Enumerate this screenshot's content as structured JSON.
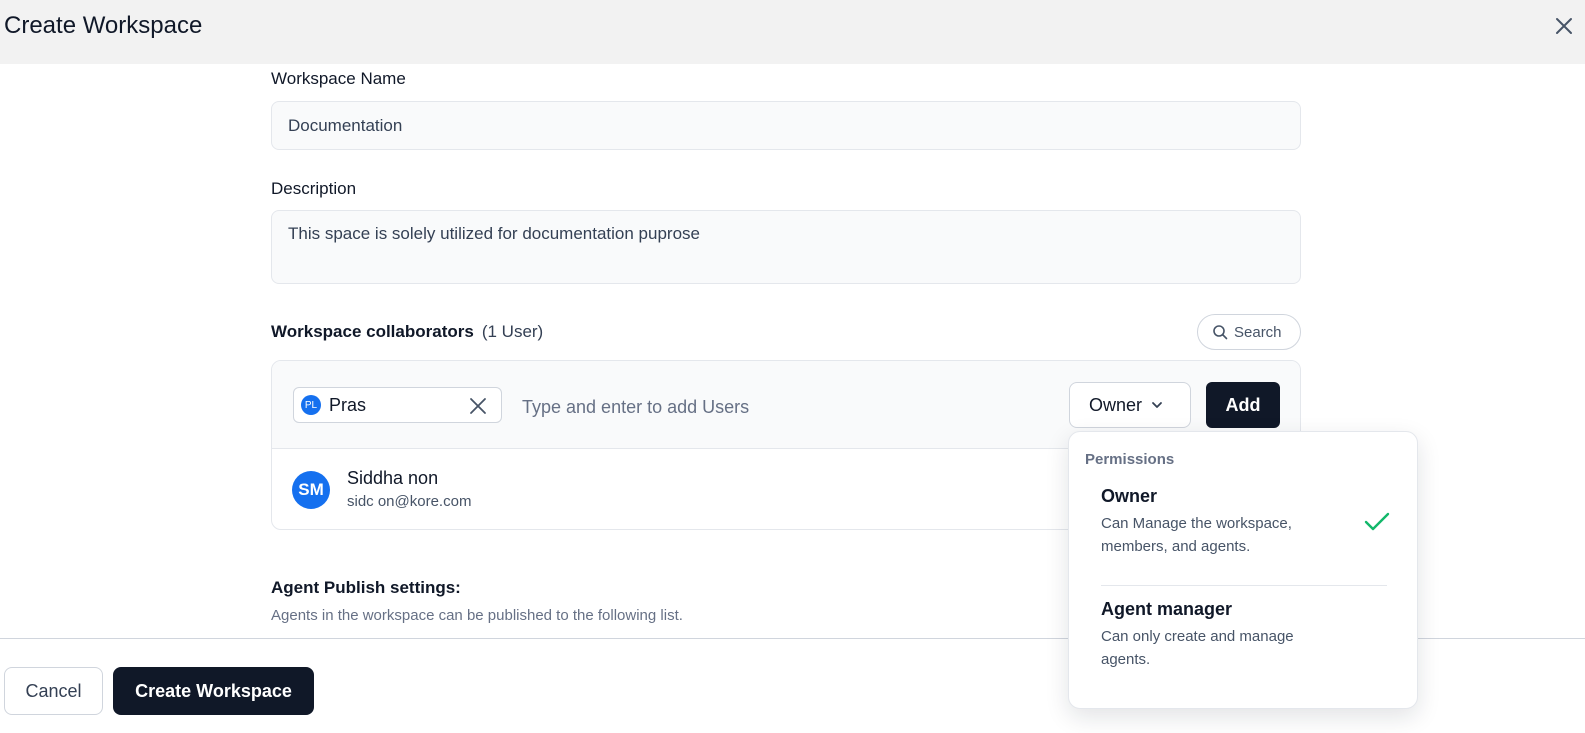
{
  "header": {
    "title": "Create Workspace"
  },
  "form": {
    "name_label": "Workspace Name",
    "name_value": "Documentation",
    "description_label": "Description",
    "description_value": "This space is solely utilized for documentation puprose"
  },
  "collaborators": {
    "title": "Workspace collaborators",
    "count": "(1 User)",
    "search_label": "Search",
    "chip_initials": "PL",
    "chip_text": "Pras",
    "input_placeholder": "Type and enter to add Users",
    "role_value": "Owner",
    "add_label": "Add",
    "users": [
      {
        "initials": "SM",
        "name": "Siddha       non",
        "email": "sidc             on@kore.com"
      }
    ]
  },
  "publish": {
    "title": "Agent Publish settings:",
    "description": "Agents in the workspace can be published to the following list."
  },
  "footer": {
    "cancel_label": "Cancel",
    "create_label": "Create Workspace"
  },
  "permissions_dropdown": {
    "heading": "Permissions",
    "options": [
      {
        "title": "Owner",
        "description": "Can Manage the workspace, members, and agents.",
        "selected": true
      },
      {
        "title": "Agent manager",
        "description": "Can only create and manage agents.",
        "selected": false
      }
    ]
  },
  "colors": {
    "primary_dark": "#101828",
    "avatar_blue": "#1570ef",
    "check_green": "#12b76a",
    "header_bg": "#f2f2f2"
  },
  "icons": {
    "close": "close-icon",
    "search": "search-icon",
    "chevron": "chevron-down-icon",
    "remove": "remove-icon",
    "check": "check-icon"
  }
}
